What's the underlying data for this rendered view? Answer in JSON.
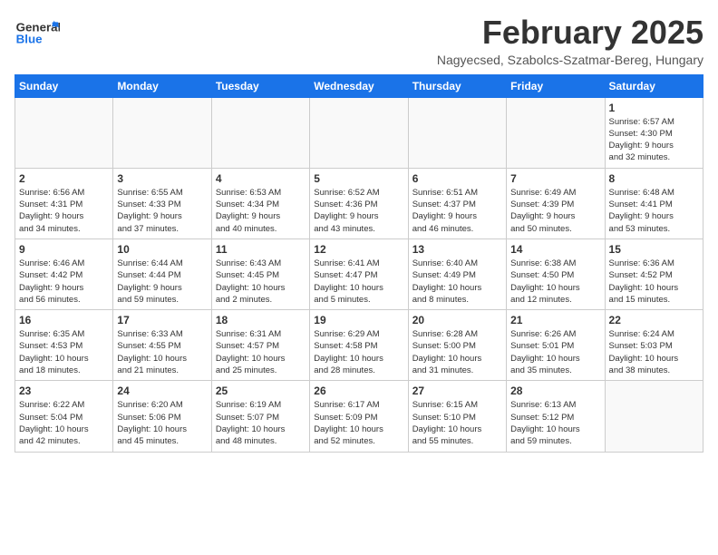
{
  "header": {
    "logo_general": "General",
    "logo_blue": "Blue",
    "month_title": "February 2025",
    "location": "Nagyecsed, Szabolcs-Szatmar-Bereg, Hungary"
  },
  "weekdays": [
    "Sunday",
    "Monday",
    "Tuesday",
    "Wednesday",
    "Thursday",
    "Friday",
    "Saturday"
  ],
  "weeks": [
    [
      {
        "day": "",
        "info": ""
      },
      {
        "day": "",
        "info": ""
      },
      {
        "day": "",
        "info": ""
      },
      {
        "day": "",
        "info": ""
      },
      {
        "day": "",
        "info": ""
      },
      {
        "day": "",
        "info": ""
      },
      {
        "day": "1",
        "info": "Sunrise: 6:57 AM\nSunset: 4:30 PM\nDaylight: 9 hours\nand 32 minutes."
      }
    ],
    [
      {
        "day": "2",
        "info": "Sunrise: 6:56 AM\nSunset: 4:31 PM\nDaylight: 9 hours\nand 34 minutes."
      },
      {
        "day": "3",
        "info": "Sunrise: 6:55 AM\nSunset: 4:33 PM\nDaylight: 9 hours\nand 37 minutes."
      },
      {
        "day": "4",
        "info": "Sunrise: 6:53 AM\nSunset: 4:34 PM\nDaylight: 9 hours\nand 40 minutes."
      },
      {
        "day": "5",
        "info": "Sunrise: 6:52 AM\nSunset: 4:36 PM\nDaylight: 9 hours\nand 43 minutes."
      },
      {
        "day": "6",
        "info": "Sunrise: 6:51 AM\nSunset: 4:37 PM\nDaylight: 9 hours\nand 46 minutes."
      },
      {
        "day": "7",
        "info": "Sunrise: 6:49 AM\nSunset: 4:39 PM\nDaylight: 9 hours\nand 50 minutes."
      },
      {
        "day": "8",
        "info": "Sunrise: 6:48 AM\nSunset: 4:41 PM\nDaylight: 9 hours\nand 53 minutes."
      }
    ],
    [
      {
        "day": "9",
        "info": "Sunrise: 6:46 AM\nSunset: 4:42 PM\nDaylight: 9 hours\nand 56 minutes."
      },
      {
        "day": "10",
        "info": "Sunrise: 6:44 AM\nSunset: 4:44 PM\nDaylight: 9 hours\nand 59 minutes."
      },
      {
        "day": "11",
        "info": "Sunrise: 6:43 AM\nSunset: 4:45 PM\nDaylight: 10 hours\nand 2 minutes."
      },
      {
        "day": "12",
        "info": "Sunrise: 6:41 AM\nSunset: 4:47 PM\nDaylight: 10 hours\nand 5 minutes."
      },
      {
        "day": "13",
        "info": "Sunrise: 6:40 AM\nSunset: 4:49 PM\nDaylight: 10 hours\nand 8 minutes."
      },
      {
        "day": "14",
        "info": "Sunrise: 6:38 AM\nSunset: 4:50 PM\nDaylight: 10 hours\nand 12 minutes."
      },
      {
        "day": "15",
        "info": "Sunrise: 6:36 AM\nSunset: 4:52 PM\nDaylight: 10 hours\nand 15 minutes."
      }
    ],
    [
      {
        "day": "16",
        "info": "Sunrise: 6:35 AM\nSunset: 4:53 PM\nDaylight: 10 hours\nand 18 minutes."
      },
      {
        "day": "17",
        "info": "Sunrise: 6:33 AM\nSunset: 4:55 PM\nDaylight: 10 hours\nand 21 minutes."
      },
      {
        "day": "18",
        "info": "Sunrise: 6:31 AM\nSunset: 4:57 PM\nDaylight: 10 hours\nand 25 minutes."
      },
      {
        "day": "19",
        "info": "Sunrise: 6:29 AM\nSunset: 4:58 PM\nDaylight: 10 hours\nand 28 minutes."
      },
      {
        "day": "20",
        "info": "Sunrise: 6:28 AM\nSunset: 5:00 PM\nDaylight: 10 hours\nand 31 minutes."
      },
      {
        "day": "21",
        "info": "Sunrise: 6:26 AM\nSunset: 5:01 PM\nDaylight: 10 hours\nand 35 minutes."
      },
      {
        "day": "22",
        "info": "Sunrise: 6:24 AM\nSunset: 5:03 PM\nDaylight: 10 hours\nand 38 minutes."
      }
    ],
    [
      {
        "day": "23",
        "info": "Sunrise: 6:22 AM\nSunset: 5:04 PM\nDaylight: 10 hours\nand 42 minutes."
      },
      {
        "day": "24",
        "info": "Sunrise: 6:20 AM\nSunset: 5:06 PM\nDaylight: 10 hours\nand 45 minutes."
      },
      {
        "day": "25",
        "info": "Sunrise: 6:19 AM\nSunset: 5:07 PM\nDaylight: 10 hours\nand 48 minutes."
      },
      {
        "day": "26",
        "info": "Sunrise: 6:17 AM\nSunset: 5:09 PM\nDaylight: 10 hours\nand 52 minutes."
      },
      {
        "day": "27",
        "info": "Sunrise: 6:15 AM\nSunset: 5:10 PM\nDaylight: 10 hours\nand 55 minutes."
      },
      {
        "day": "28",
        "info": "Sunrise: 6:13 AM\nSunset: 5:12 PM\nDaylight: 10 hours\nand 59 minutes."
      },
      {
        "day": "",
        "info": ""
      }
    ]
  ]
}
